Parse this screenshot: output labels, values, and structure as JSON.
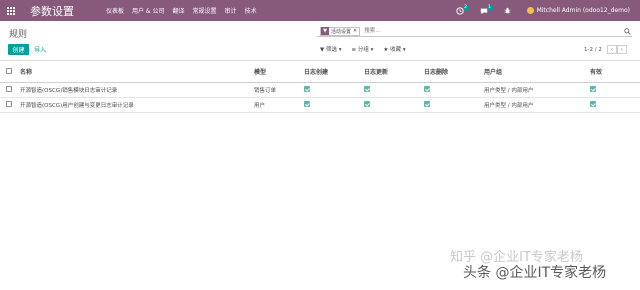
{
  "navbar": {
    "app_title": "参数设置",
    "menu": [
      "仪表板",
      "用户 & 公司",
      "翻译",
      "常规设置",
      "审计",
      "技术"
    ],
    "activity_count": "2",
    "message_count": "1",
    "user": "Mitchell Admin (odoo12_demo)",
    "color": "#875a7b"
  },
  "control_panel": {
    "breadcrumb": "规则",
    "search": {
      "facet_label": "活动设置",
      "placeholder": "搜索..."
    },
    "create_label": "创建",
    "import_label": "导入",
    "filters_label": "筛选",
    "group_by_label": "分组",
    "favorites_label": "收藏",
    "pager": "1-2 / 2"
  },
  "table": {
    "columns": [
      "名称",
      "模型",
      "日志创建",
      "日志更新",
      "日志删除",
      "用户组",
      "有效"
    ],
    "rows": [
      {
        "name": "开源智造(OSCG)销售模块日志审计记录",
        "model": "销售订单",
        "log_create": true,
        "log_write": true,
        "log_unlink": true,
        "groups": "用户类型 / 内部用户",
        "active": true
      },
      {
        "name": "开源智造(OSCG)用户创建与变更日志审计记录",
        "model": "用户",
        "log_create": true,
        "log_write": true,
        "log_unlink": true,
        "groups": "用户类型 / 内部用户",
        "active": true
      }
    ]
  },
  "watermarks": {
    "top": "知乎 @企业IT专家老杨",
    "bottom": "头条 @企业IT专家老杨"
  }
}
